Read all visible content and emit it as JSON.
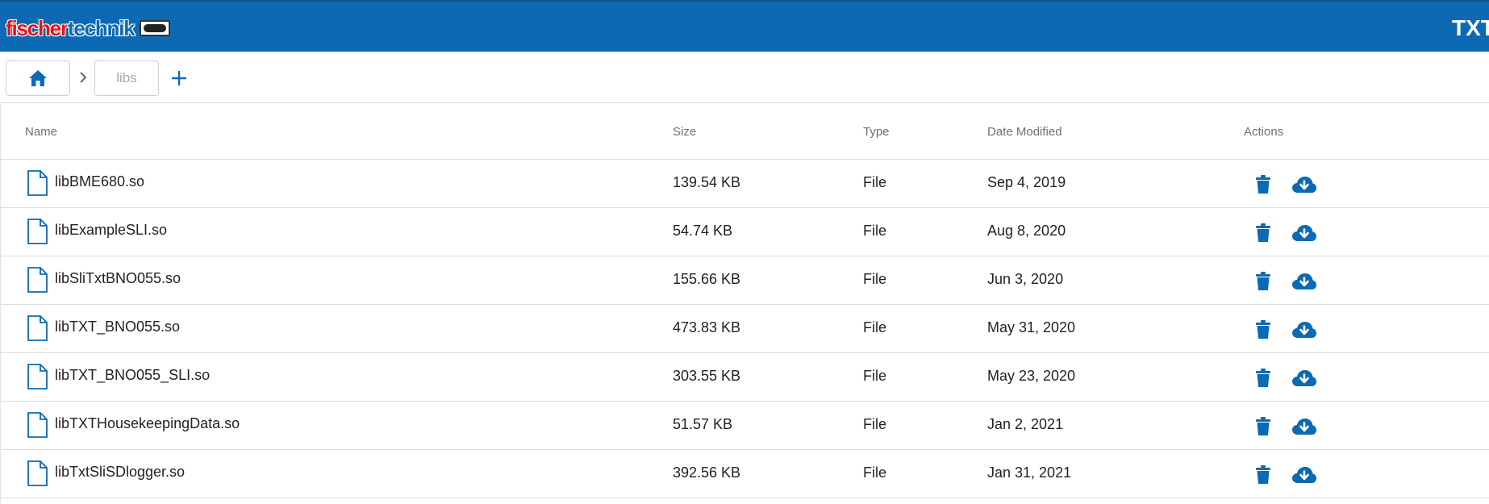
{
  "header": {
    "logo_text_red": "fischer",
    "logo_text_blue": "technik",
    "title": "TXT",
    "bar_color": "#0b6ab3"
  },
  "breadcrumb": {
    "home_icon": "home-icon",
    "separator_icon": "chevron-right-icon",
    "current_folder": "libs",
    "add_icon": "plus-icon"
  },
  "table": {
    "columns": {
      "name": "Name",
      "size": "Size",
      "type": "Type",
      "date": "Date Modified",
      "actions": "Actions"
    },
    "rows": [
      {
        "name": "libBME680.so",
        "size": "139.54 KB",
        "type": "File",
        "date": "Sep 4, 2019"
      },
      {
        "name": "libExampleSLI.so",
        "size": "54.74 KB",
        "type": "File",
        "date": "Aug 8, 2020"
      },
      {
        "name": "libSliTxtBNO055.so",
        "size": "155.66 KB",
        "type": "File",
        "date": "Jun 3, 2020"
      },
      {
        "name": "libTXT_BNO055.so",
        "size": "473.83 KB",
        "type": "File",
        "date": "May 31, 2020"
      },
      {
        "name": "libTXT_BNO055_SLI.so",
        "size": "303.55 KB",
        "type": "File",
        "date": "May 23, 2020"
      },
      {
        "name": "libTXTHousekeepingData.so",
        "size": "51.57 KB",
        "type": "File",
        "date": "Jan 2, 2021"
      },
      {
        "name": "libTxtSliSDlogger.so",
        "size": "392.56 KB",
        "type": "File",
        "date": "Jan 31, 2021"
      }
    ],
    "row_icons": {
      "file": "file-icon",
      "delete": "trash-icon",
      "download": "cloud-download-icon"
    }
  },
  "colors": {
    "accent": "#0b6ab3",
    "border": "#dcdcdc",
    "header_text": "#707070"
  }
}
